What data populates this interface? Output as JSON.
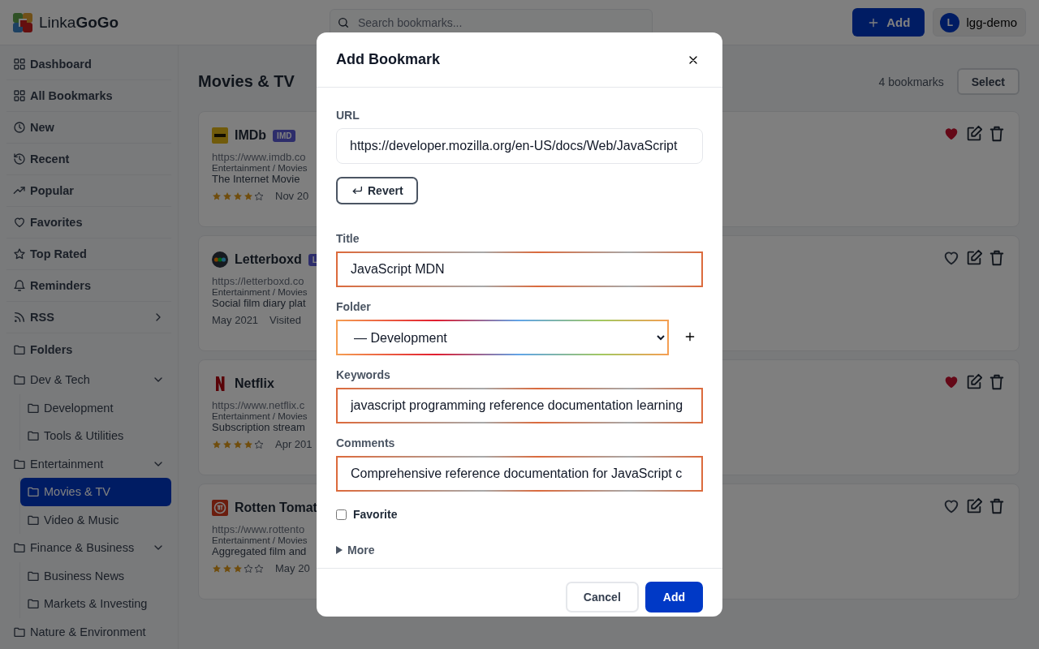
{
  "header": {
    "brand": "Linka**GoGo**",
    "search": {
      "placeholder": "Search bookmarks..."
    },
    "add_button": "Add",
    "user": {
      "initial": "L",
      "name": "lgg-demo"
    }
  },
  "sidebar": {
    "items": [
      {
        "label": "Dashboard",
        "selected": false
      },
      {
        "label": "All Bookmarks",
        "selected": false
      },
      {
        "label": "New",
        "selected": false
      },
      {
        "label": "Recent",
        "selected": false
      },
      {
        "label": "Popular",
        "selected": false
      },
      {
        "label": "Favorites",
        "selected": false
      },
      {
        "label": "Top Rated",
        "selected": false
      },
      {
        "label": "Reminders",
        "selected": false
      },
      {
        "label": "RSS",
        "selected": false,
        "has_submenu": true
      }
    ],
    "folders_heading": "Folders",
    "folders": [
      {
        "label": "Dev & Tech",
        "expanded": true,
        "selected": false,
        "children": [
          {
            "label": "Development",
            "selected": false
          },
          {
            "label": "Tools & Utilities",
            "selected": false
          }
        ]
      },
      {
        "label": "Entertainment",
        "expanded": true,
        "selected": false,
        "children": [
          {
            "label": "Movies & TV",
            "selected": true
          },
          {
            "label": "Video & Music",
            "selected": false
          }
        ]
      },
      {
        "label": "Finance & Business",
        "expanded": true,
        "selected": false,
        "children": [
          {
            "label": "Business News",
            "selected": false
          },
          {
            "label": "Markets & Investing",
            "selected": false
          }
        ]
      },
      {
        "label": "Nature & Environment",
        "selected": false
      }
    ]
  },
  "main": {
    "title": "Movies & TV",
    "count": "4 bookmarks",
    "select_button": "Select",
    "bookmarks": [
      {
        "title": "IMDb",
        "badge": "IMD",
        "url": "https://www.imdb.co",
        "path": "Entertainment / Movies",
        "description": "The Internet Movie",
        "stars": 4,
        "date": "Nov 20",
        "favorite": true
      },
      {
        "title": "Letterboxd",
        "badge": "L",
        "url": "https://letterboxd.co",
        "path": "Entertainment / Movies",
        "description": "Social film diary plat",
        "date": "May 2021",
        "visited": "Visited",
        "favorite": false
      },
      {
        "title": "Netflix",
        "url": "https://www.netflix.c",
        "path": "Entertainment / Movies",
        "description": "Subscription stream",
        "stars": 4,
        "date": "Apr 201",
        "favorite": true
      },
      {
        "title": "Rotten Tomat",
        "url": "https://www.rottento",
        "path": "Entertainment / Movies",
        "description": "Aggregated film and",
        "stars": 3,
        "date": "May 20",
        "favorite": false
      }
    ]
  },
  "dialog": {
    "title": "Add Bookmark",
    "fields": [
      {
        "kind": "text",
        "label": "URL",
        "value": "https://developer.mozilla.org/en-US/docs/Web/JavaScript"
      },
      {
        "kind": "revert",
        "label": "Revert"
      },
      {
        "kind": "text",
        "label": "Title",
        "value": "JavaScript MDN",
        "highlighted": true
      },
      {
        "kind": "select",
        "label": "Folder",
        "value": "— Development",
        "highlighted": true
      },
      {
        "kind": "text",
        "label": "Keywords",
        "value": "javascript programming reference documentation learning",
        "highlighted": true
      },
      {
        "kind": "text",
        "label": "Comments",
        "value": "Comprehensive reference documentation for JavaScript c",
        "highlighted": true
      },
      {
        "kind": "checkbox",
        "label": "Favorite",
        "checked": false
      },
      {
        "kind": "disclosure",
        "label": "More",
        "expanded": false
      }
    ],
    "buttons": [
      {
        "label": "Cancel",
        "primary": false
      },
      {
        "label": "Add",
        "primary": true
      }
    ]
  }
}
